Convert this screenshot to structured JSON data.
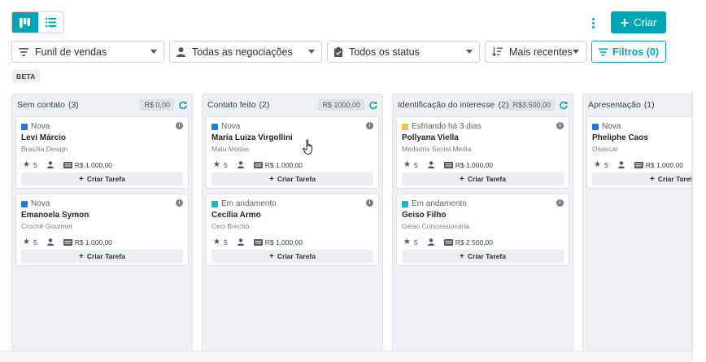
{
  "toolbar": {
    "create_label": "Criar",
    "filters": [
      {
        "label": "Funil de vendas",
        "icon": "sort-lines-icon"
      },
      {
        "label": "Todas as negociações",
        "icon": "user-icon"
      },
      {
        "label": "Todos os status",
        "icon": "clipboard-icon"
      },
      {
        "label": "Mais recentes",
        "icon": "sort-order-icon"
      },
      {
        "label": "Filtros (0)",
        "icon": "filter-icon"
      }
    ],
    "beta_label": "BETA"
  },
  "colors": {
    "accent": "#00a6b8",
    "status_new": "#1e7be0",
    "status_cooling": "#f2bf4b",
    "status_progress": "#1ab7c6"
  },
  "columns": [
    {
      "title": "Sem contato",
      "count": "(3)",
      "amount": "R$ 0,00",
      "cards": [
        {
          "status": "Nova",
          "name": "Levi Márcio",
          "company": "Brasília Design",
          "rating": "5",
          "value": "R$ 1.000,00",
          "task_label": "Criar Tarefa"
        },
        {
          "status": "Nova",
          "name": "Emanoela Symon",
          "company": "Crochê Gourmet",
          "rating": "5",
          "value": "R$ 1.000,00",
          "task_label": "Criar Tarefa"
        }
      ]
    },
    {
      "title": "Contato feito",
      "count": "(2)",
      "amount": "R$ 1000,00",
      "cards": [
        {
          "status": "Nova",
          "name": "Maria Luiza Virgollini",
          "company": "Malu Modas",
          "rating": "5",
          "value": "R$ 1.000,00",
          "task_label": "Criar Tarefa"
        },
        {
          "status": "Em andamento",
          "name": "Cecília Armo",
          "company": "Ceci Brechó",
          "rating": "5",
          "value": "R$ 1.000,00",
          "task_label": "Criar Tarefa"
        }
      ]
    },
    {
      "title": "Identificação do interesse...",
      "count": "(2)",
      "amount": "R$3.500,00",
      "cards": [
        {
          "status": "Esfriando há 3 dias",
          "name": "Pollyana Viella",
          "company": "Mediatrix Social Media",
          "rating": "5",
          "value": "R$ 1.000,00",
          "task_label": "Criar Tarefa"
        },
        {
          "status": "Em andamento",
          "name": "Geiso Filho",
          "company": "Geiso Concessionária",
          "rating": "5",
          "value": "R$ 2.500,00",
          "task_label": "Criar Tarefa"
        }
      ]
    },
    {
      "title": "Apresentação",
      "count": "(1)",
      "cards": [
        {
          "status": "Nova",
          "name": "Pheliphe Caos",
          "company": "Osascar",
          "rating": "5",
          "value": "R$ 1.000,00",
          "task_label": "Criar Tarefa"
        }
      ]
    }
  ]
}
